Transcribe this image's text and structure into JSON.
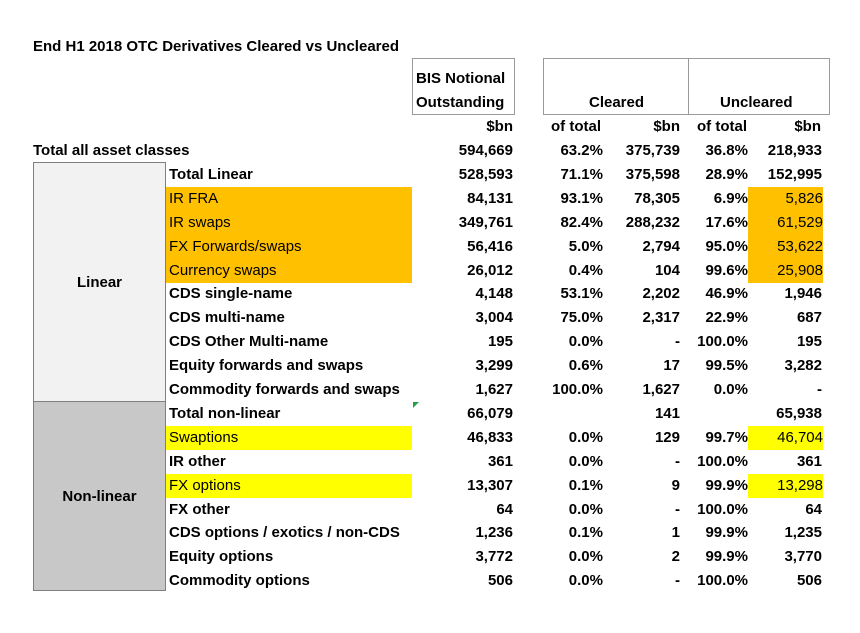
{
  "title": "End H1 2018 OTC Derivatives Cleared vs Uncleared",
  "headers": {
    "bis_line1": "BIS Notional",
    "bis_line2": "Outstanding",
    "cleared": "Cleared",
    "uncleared": "Uncleared",
    "sub": [
      "$bn",
      "of total",
      "$bn",
      "of total",
      "$bn"
    ]
  },
  "groups": {
    "linear": "Linear",
    "nonlinear": "Non-linear"
  },
  "highlight_colors": {
    "orange": "#ffc000",
    "yellow": "#ffff00"
  },
  "rows": [
    {
      "label": "Total all asset classes",
      "bis": "594,669",
      "cl_pct": "63.2%",
      "cl_bn": "375,739",
      "un_pct": "36.8%",
      "un_bn": "218,933"
    },
    {
      "label": "Total Linear",
      "bis": "528,593",
      "cl_pct": "71.1%",
      "cl_bn": "375,598",
      "un_pct": "28.9%",
      "un_bn": "152,995"
    },
    {
      "label": "IR FRA",
      "bis": "84,131",
      "cl_pct": "93.1%",
      "cl_bn": "78,305",
      "un_pct": "6.9%",
      "un_bn": "5,826"
    },
    {
      "label": "IR swaps",
      "bis": "349,761",
      "cl_pct": "82.4%",
      "cl_bn": "288,232",
      "un_pct": "17.6%",
      "un_bn": "61,529"
    },
    {
      "label": "FX Forwards/swaps",
      "bis": "56,416",
      "cl_pct": "5.0%",
      "cl_bn": "2,794",
      "un_pct": "95.0%",
      "un_bn": "53,622"
    },
    {
      "label": "Currency swaps",
      "bis": "26,012",
      "cl_pct": "0.4%",
      "cl_bn": "104",
      "un_pct": "99.6%",
      "un_bn": "25,908"
    },
    {
      "label": "CDS single-name",
      "bis": "4,148",
      "cl_pct": "53.1%",
      "cl_bn": "2,202",
      "un_pct": "46.9%",
      "un_bn": "1,946"
    },
    {
      "label": "CDS multi-name",
      "bis": "3,004",
      "cl_pct": "75.0%",
      "cl_bn": "2,317",
      "un_pct": "22.9%",
      "un_bn": "687"
    },
    {
      "label": "CDS Other Multi-name",
      "bis": "195",
      "cl_pct": "0.0%",
      "cl_bn": "-",
      "un_pct": "100.0%",
      "un_bn": "195"
    },
    {
      "label": "Equity forwards and swaps",
      "bis": "3,299",
      "cl_pct": "0.6%",
      "cl_bn": "17",
      "un_pct": "99.5%",
      "un_bn": "3,282"
    },
    {
      "label": "Commodity forwards and swaps",
      "bis": "1,627",
      "cl_pct": "100.0%",
      "cl_bn": "1,627",
      "un_pct": "0.0%",
      "un_bn": "-"
    },
    {
      "label": "Total non-linear",
      "bis": "66,079",
      "cl_pct": "",
      "cl_bn": "141",
      "un_pct": "",
      "un_bn": "65,938"
    },
    {
      "label": "Swaptions",
      "bis": "46,833",
      "cl_pct": "0.0%",
      "cl_bn": "129",
      "un_pct": "99.7%",
      "un_bn": "46,704"
    },
    {
      "label": "IR other",
      "bis": "361",
      "cl_pct": "0.0%",
      "cl_bn": "-",
      "un_pct": "100.0%",
      "un_bn": "361"
    },
    {
      "label": "FX options",
      "bis": "13,307",
      "cl_pct": "0.1%",
      "cl_bn": "9",
      "un_pct": "99.9%",
      "un_bn": "13,298"
    },
    {
      "label": "FX other",
      "bis": "64",
      "cl_pct": "0.0%",
      "cl_bn": "-",
      "un_pct": "100.0%",
      "un_bn": "64"
    },
    {
      "label": "CDS options / exotics / non-CDS",
      "bis": "1,236",
      "cl_pct": "0.1%",
      "cl_bn": "1",
      "un_pct": "99.9%",
      "un_bn": "1,235"
    },
    {
      "label": "Equity options",
      "bis": "3,772",
      "cl_pct": "0.0%",
      "cl_bn": "2",
      "un_pct": "99.9%",
      "un_bn": "3,770"
    },
    {
      "label": "Commodity options",
      "bis": "506",
      "cl_pct": "0.0%",
      "cl_bn": "-",
      "un_pct": "100.0%",
      "un_bn": "506"
    }
  ]
}
